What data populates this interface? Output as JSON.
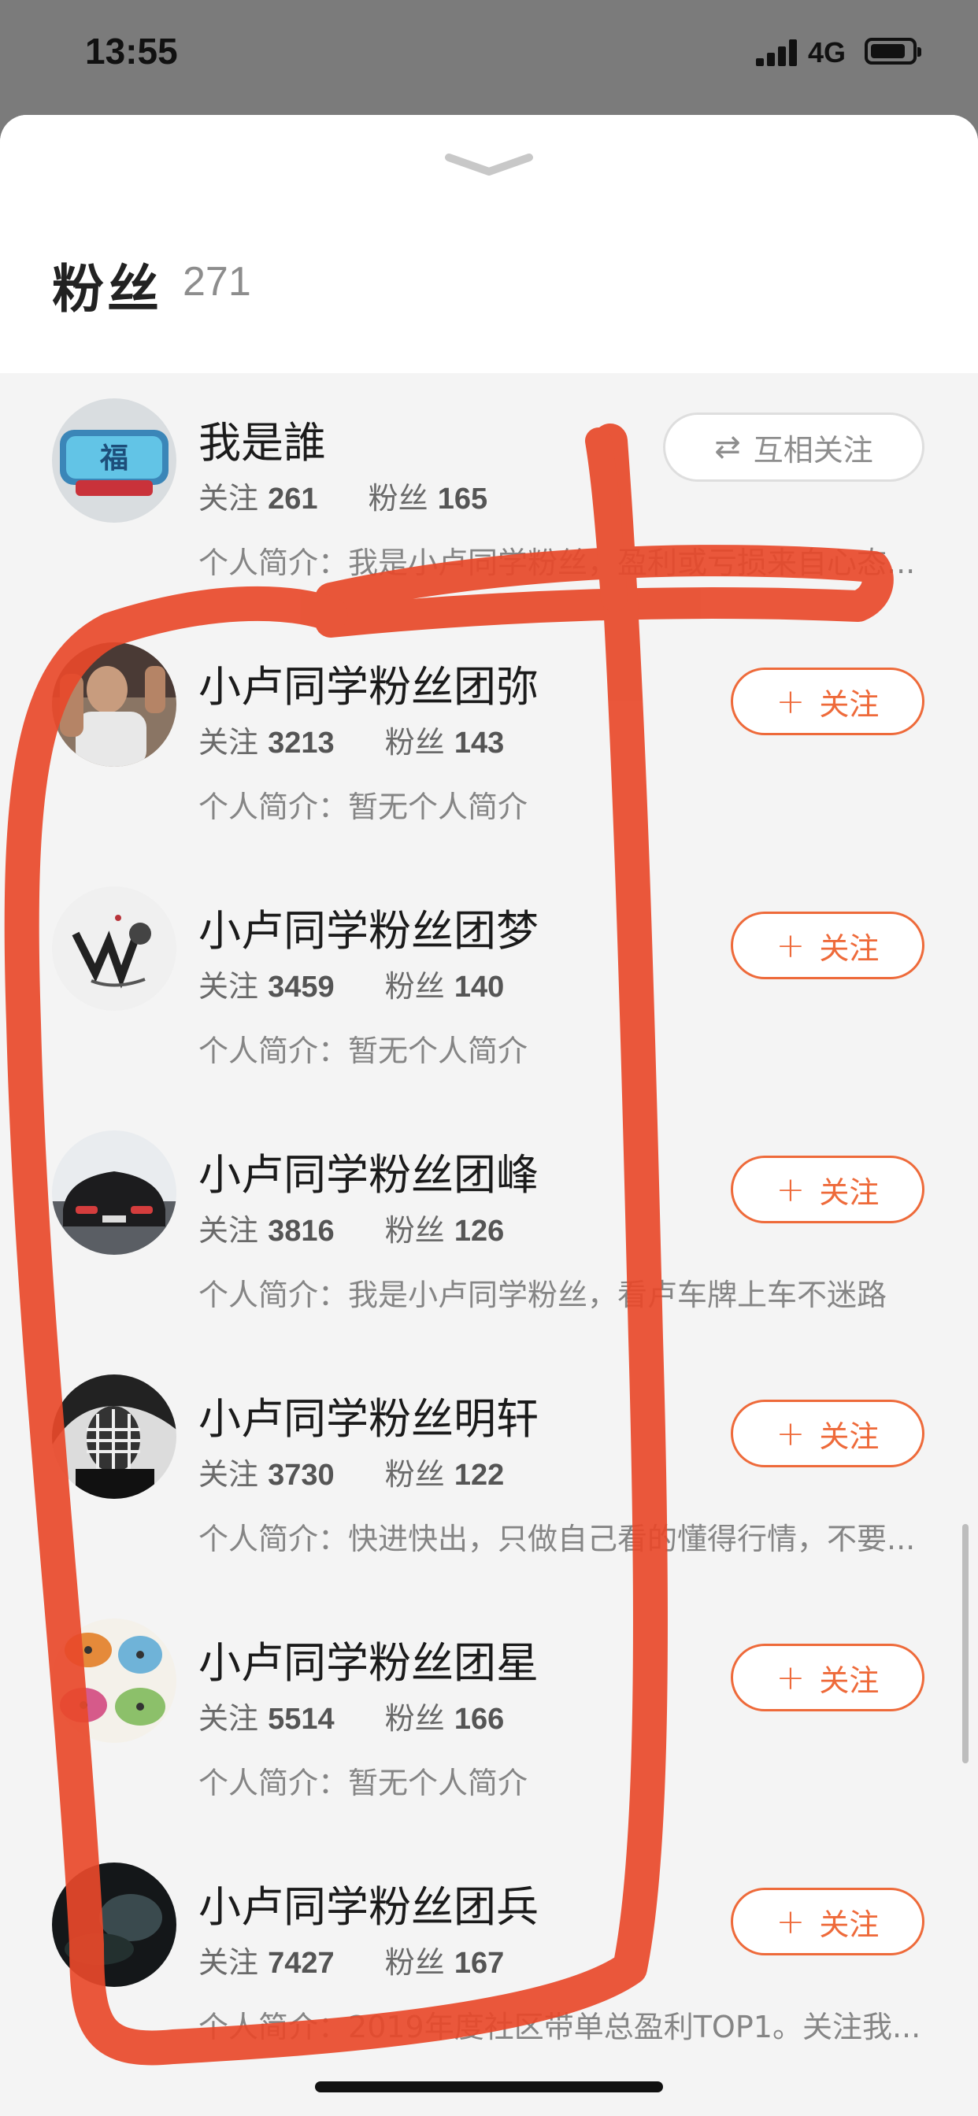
{
  "status_bar": {
    "time": "13:55",
    "network": "4G",
    "battery_level": 0.85
  },
  "header": {
    "title": "粉丝",
    "count": "271",
    "collapse_icon": "chevron-down-icon"
  },
  "labels": {
    "follow_prefix": "关注",
    "fans_prefix": "粉丝",
    "bio_prefix": "个人简介："
  },
  "users": [
    {
      "name": "我是誰",
      "following": "261",
      "fans": "165",
      "bio": "我是小卢同学粉丝，盈利或亏损来自心态...",
      "button": "互相关注",
      "button_icon": "swap-arrows-icon",
      "button_type": "mutual"
    },
    {
      "name": "小卢同学粉丝团弥",
      "following": "3213",
      "fans": "143",
      "bio": "暂无个人简介",
      "button": "关注",
      "button_icon": "plus-icon",
      "button_type": "follow"
    },
    {
      "name": "小卢同学粉丝团梦",
      "following": "3459",
      "fans": "140",
      "bio": "暂无个人简介",
      "button": "关注",
      "button_icon": "plus-icon",
      "button_type": "follow"
    },
    {
      "name": "小卢同学粉丝团峰",
      "following": "3816",
      "fans": "126",
      "bio": "我是小卢同学粉丝，看卢车牌上车不迷路",
      "button": "关注",
      "button_icon": "plus-icon",
      "button_type": "follow"
    },
    {
      "name": "小卢同学粉丝明轩",
      "following": "3730",
      "fans": "122",
      "bio": "快进快出，只做自己看的懂得行情，不要...",
      "button": "关注",
      "button_icon": "plus-icon",
      "button_type": "follow"
    },
    {
      "name": "小卢同学粉丝团星",
      "following": "5514",
      "fans": "166",
      "bio": "暂无个人简介",
      "button": "关注",
      "button_icon": "plus-icon",
      "button_type": "follow"
    },
    {
      "name": "小卢同学粉丝团兵",
      "following": "7427",
      "fans": "167",
      "bio": "2019年度社区带单总盈利TOP1。关注我...",
      "button": "关注",
      "button_icon": "plus-icon",
      "button_type": "follow"
    }
  ],
  "colors": {
    "accent": "#ee6a3a",
    "annotation": "#e8492a",
    "sheet": "#f4f4f4",
    "backdrop": "#7b7b7b"
  }
}
